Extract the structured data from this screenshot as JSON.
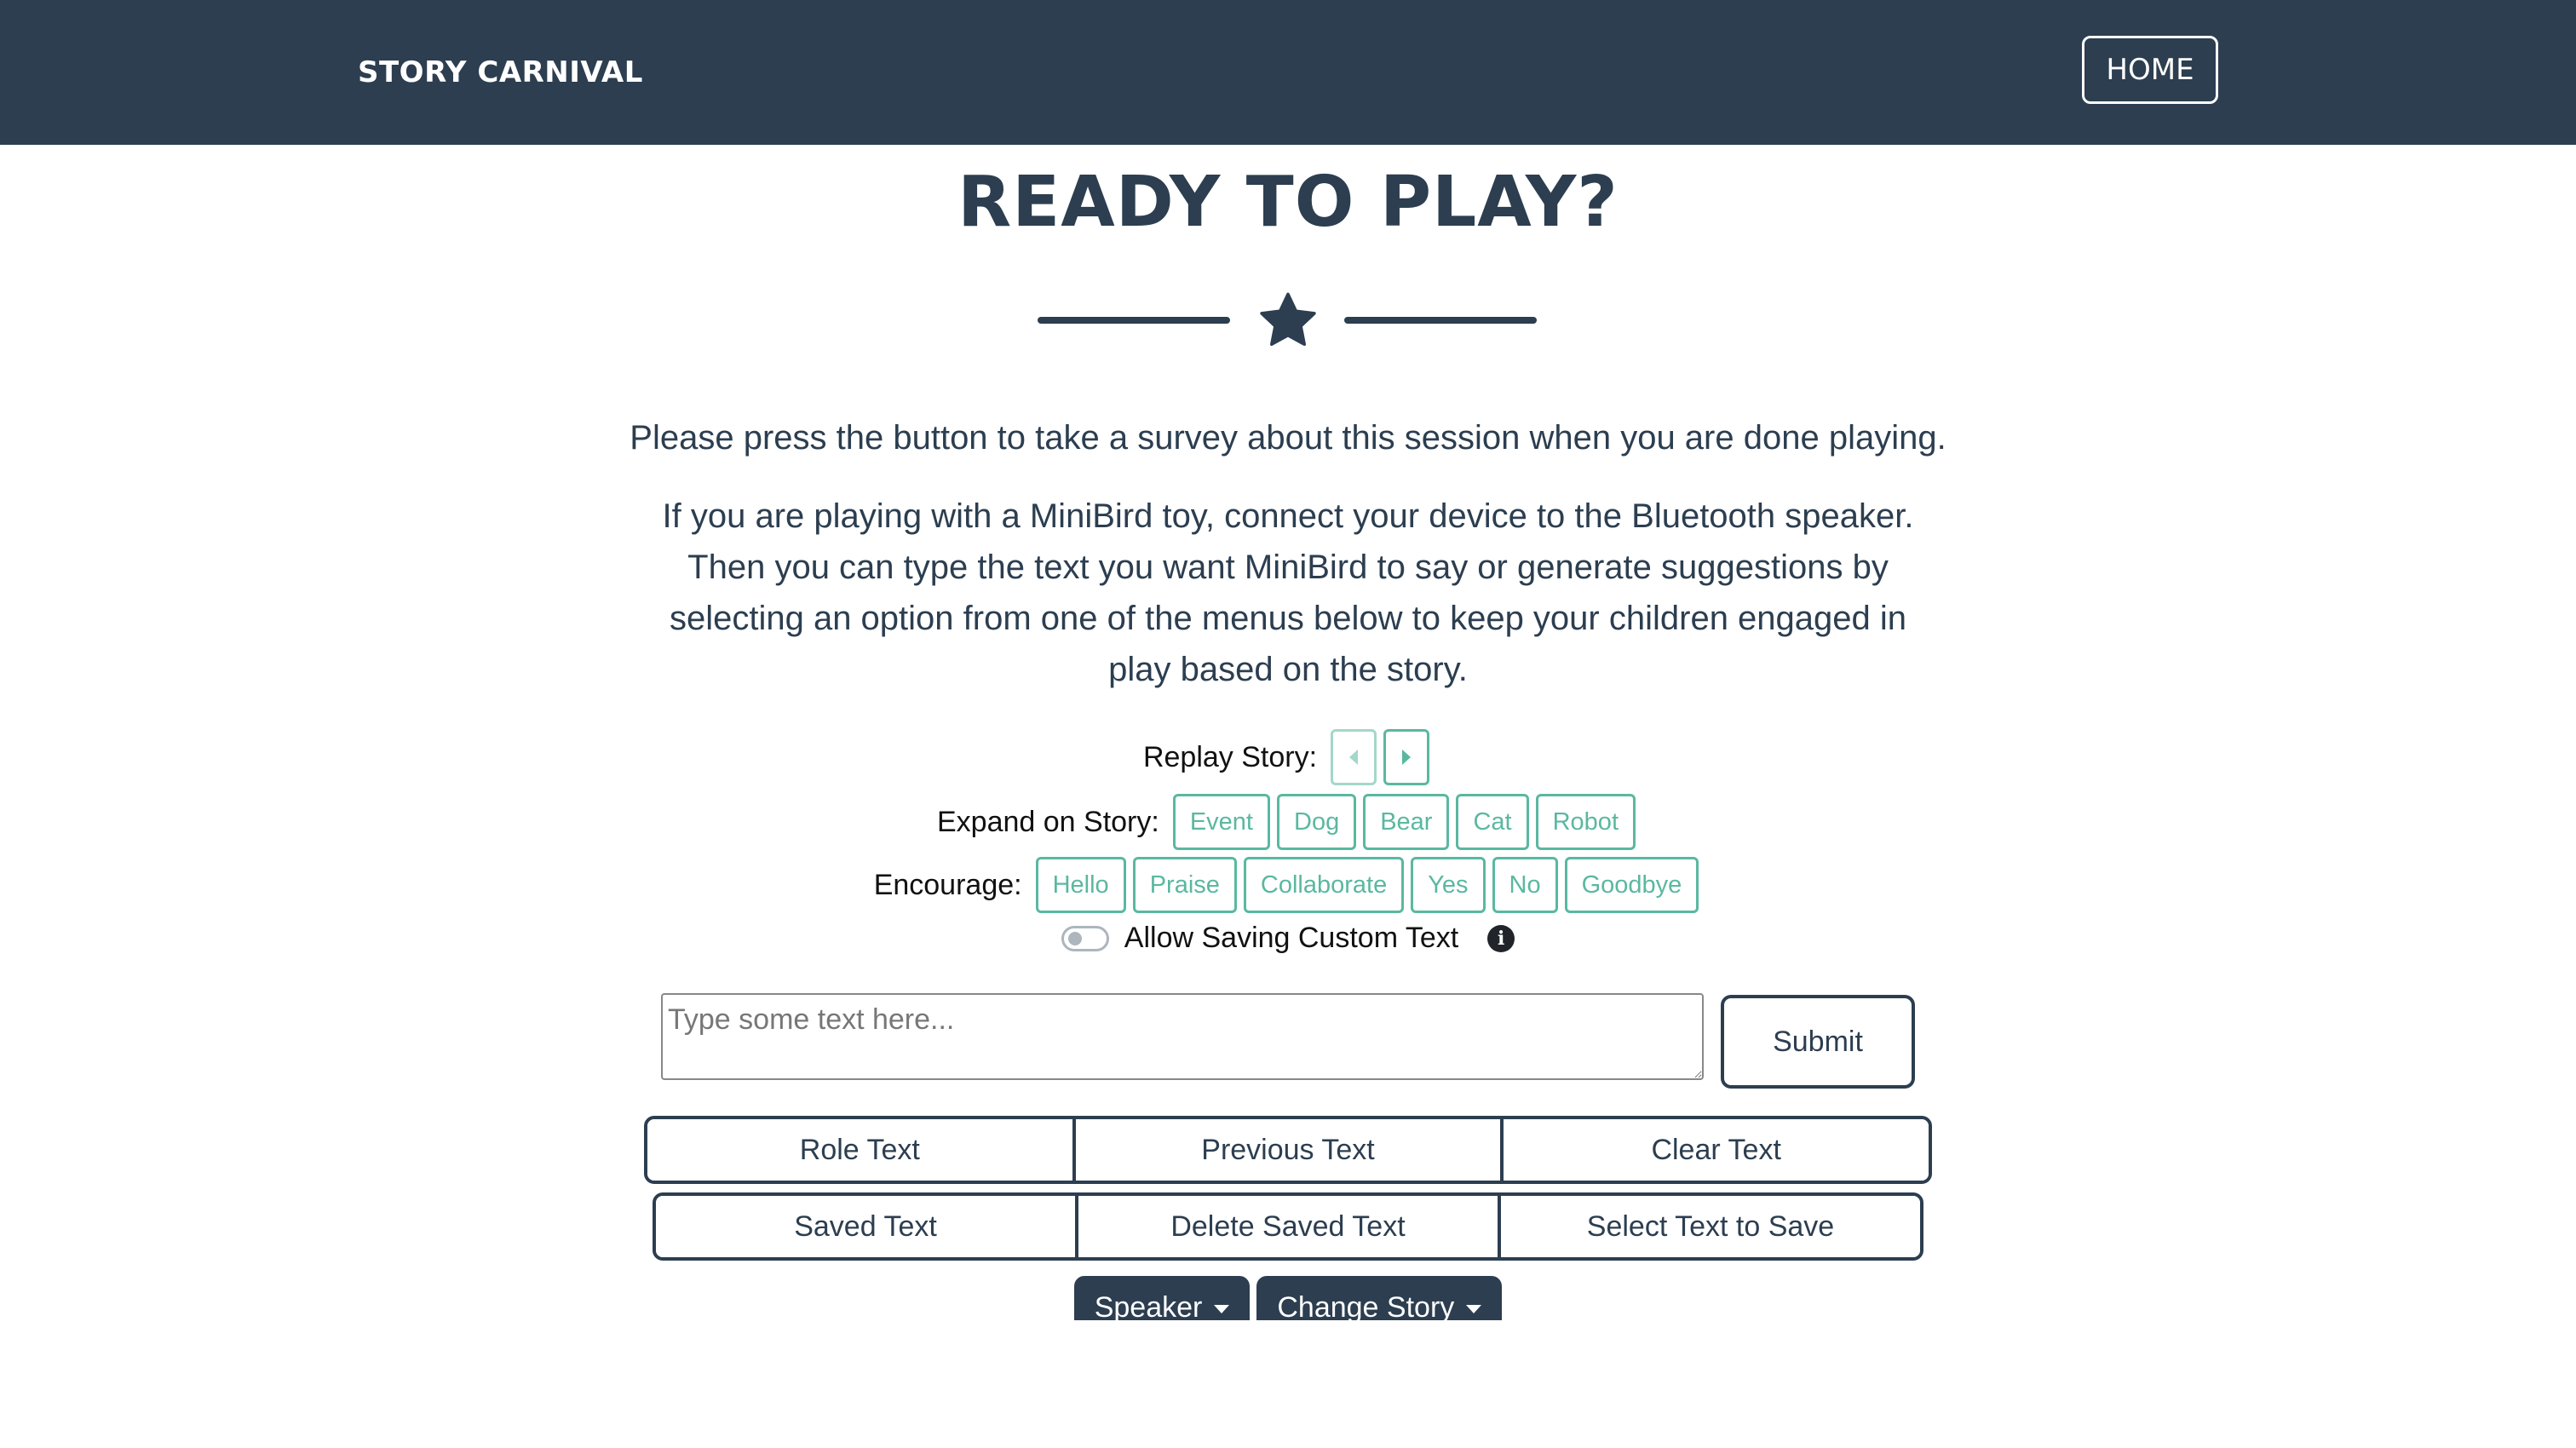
{
  "header": {
    "brand": "STORY CARNIVAL",
    "home_label": "HOME"
  },
  "main": {
    "title": "READY TO PLAY?",
    "paragraph_survey": "Please press the button to take a survey about this session when you are done playing.",
    "paragraph_instructions": "If you are playing with a MiniBird toy, connect your device to the Bluetooth speaker. Then you can type the text you want MiniBird to say or generate suggestions by selecting an option from one of the menus below to keep your children engaged in play based on the story."
  },
  "replay": {
    "label": "Replay Story:"
  },
  "expand": {
    "label": "Expand on Story:",
    "options": [
      "Event",
      "Dog",
      "Bear",
      "Cat",
      "Robot"
    ]
  },
  "encourage": {
    "label": "Encourage:",
    "options": [
      "Hello",
      "Praise",
      "Collaborate",
      "Yes",
      "No",
      "Goodbye"
    ]
  },
  "toggle": {
    "label": "Allow Saving Custom Text",
    "on": false
  },
  "input": {
    "placeholder": "Type some text here...",
    "value": "",
    "submit_label": "Submit"
  },
  "text_actions_row1": [
    "Role Text",
    "Previous Text",
    "Clear Text"
  ],
  "text_actions_row2": [
    "Saved Text",
    "Delete Saved Text",
    "Select Text to Save"
  ],
  "dropdowns": [
    "Speaker",
    "Change Story"
  ],
  "colors": {
    "primary": "#2c3e50",
    "accent": "#5ab8a0",
    "background": "#ffffff"
  },
  "icons": {
    "divider": "star-icon",
    "info": "info-icon",
    "replay_prev": "caret-left-icon",
    "replay_next": "caret-right-icon"
  }
}
